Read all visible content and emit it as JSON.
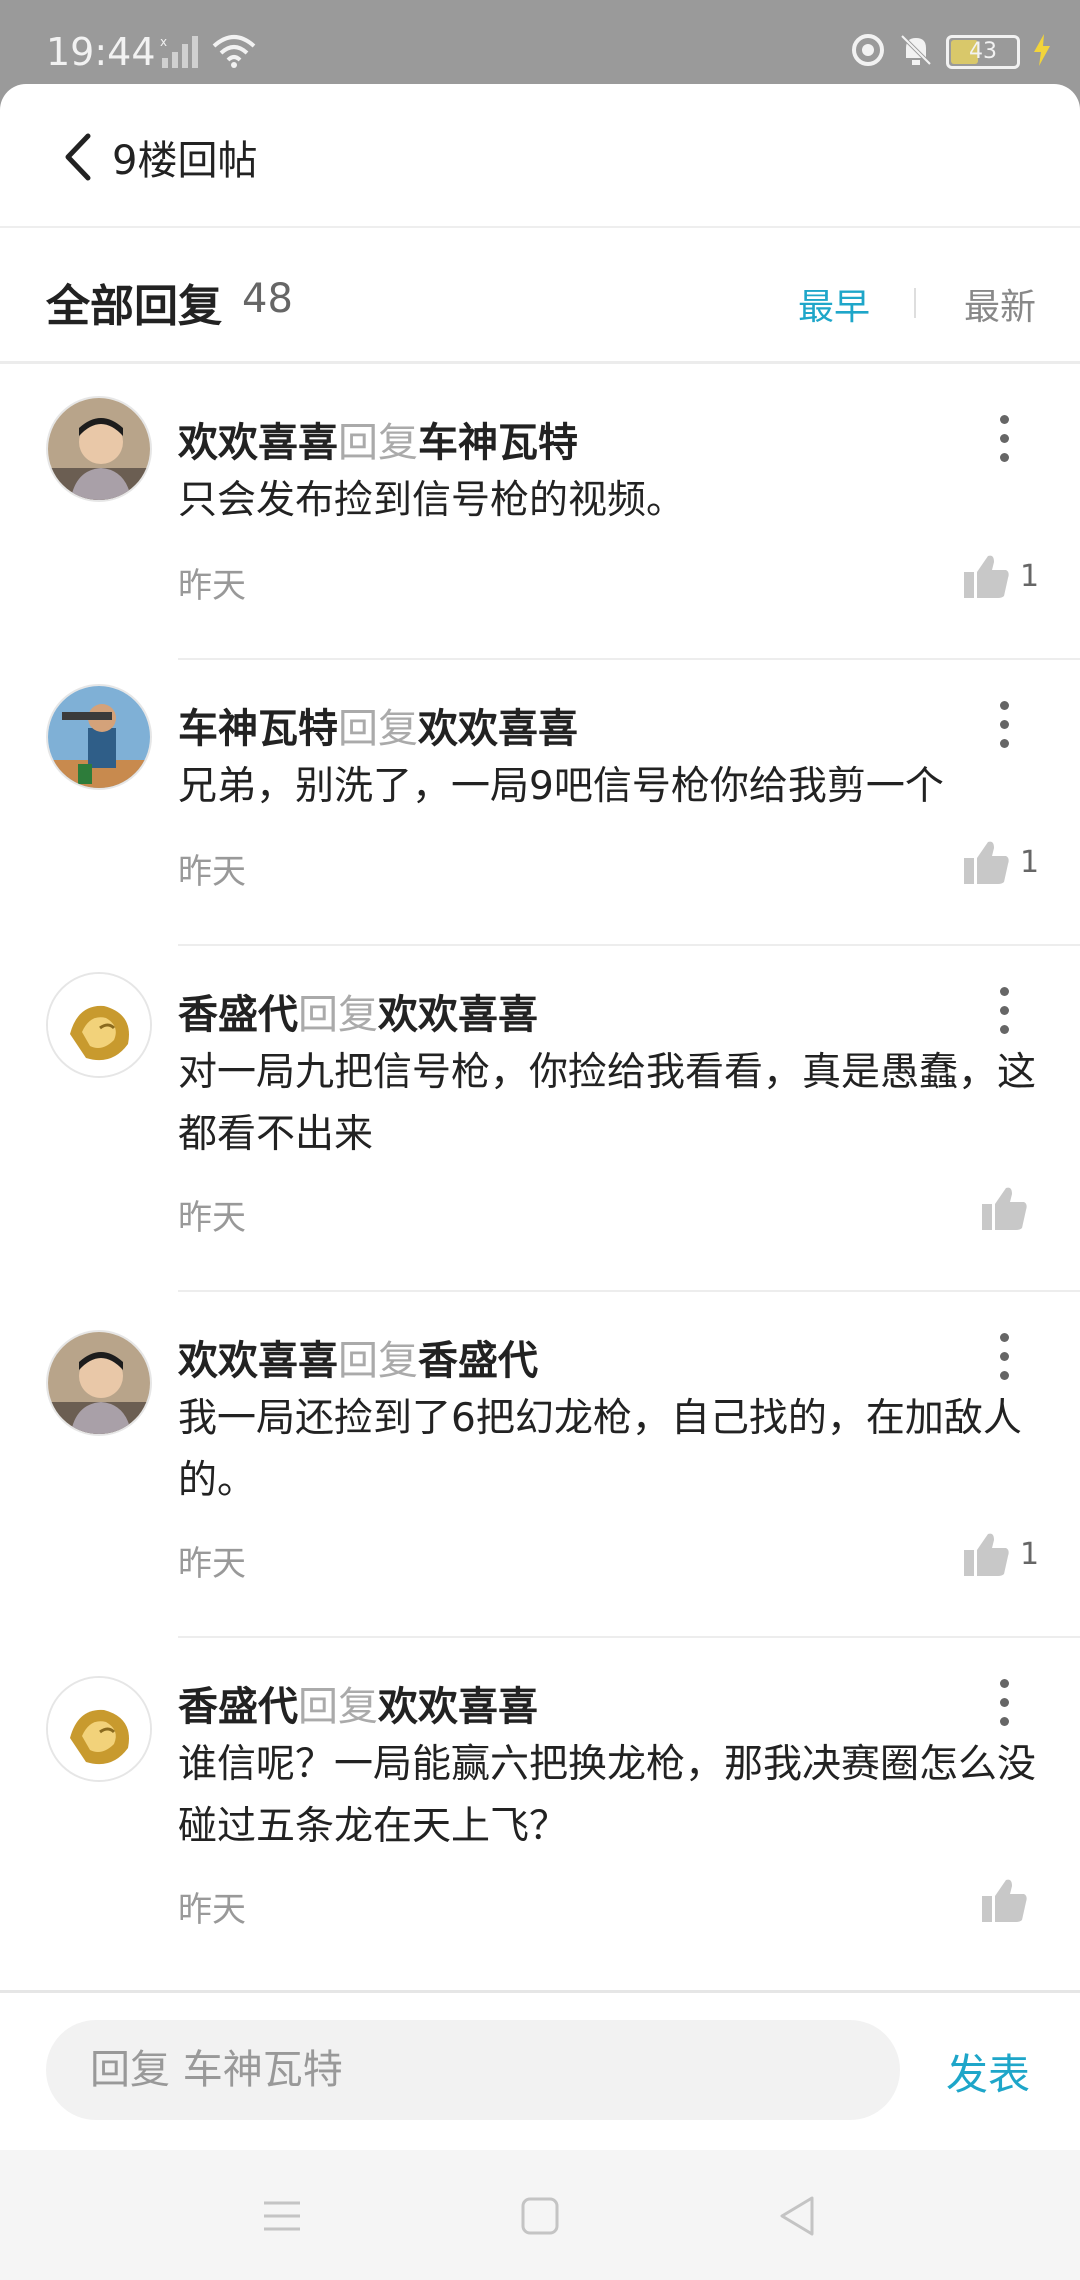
{
  "status_bar": {
    "time": "19:44",
    "battery": "43",
    "icons": [
      "signal-icon",
      "wifi-icon",
      "alarm-icon",
      "mute-icon",
      "battery-icon",
      "charging-icon"
    ]
  },
  "header": {
    "title": "9楼回帖"
  },
  "section": {
    "title": "全部回复",
    "count": "48",
    "sort_earliest": "最早",
    "sort_newest": "最新",
    "accent_color": "#1ea6c9"
  },
  "replies": [
    {
      "author": "欢欢喜喜",
      "verb": "回复",
      "target": "车神瓦特",
      "text": "只会发布捡到信号枪的视频。",
      "time": "昨天",
      "likes": "1",
      "avatar": "boy-avatar"
    },
    {
      "author": "车神瓦特",
      "verb": "回复",
      "target": "欢欢喜喜",
      "text": "兄弟，别洗了，一局9吧信号枪你给我剪一个",
      "time": "昨天",
      "likes": "1",
      "avatar": "game-character-avatar"
    },
    {
      "author": "香盛代",
      "verb": "回复",
      "target": "欢欢喜喜",
      "text": "对一局九把信号枪，你捡给我看看，真是愚蠢，这都看不出来",
      "time": "昨天",
      "likes": "",
      "avatar": "durian-avatar"
    },
    {
      "author": "欢欢喜喜",
      "verb": "回复",
      "target": "香盛代",
      "text": "我一局还捡到了6把幻龙枪，自己找的，在加敌人的。",
      "time": "昨天",
      "likes": "1",
      "avatar": "boy-avatar"
    },
    {
      "author": "香盛代",
      "verb": "回复",
      "target": "欢欢喜喜",
      "text": "谁信呢？一局能赢六把换龙枪，那我决赛圈怎么没碰过五条龙在天上飞？",
      "time": "昨天",
      "likes": "",
      "avatar": "durian-avatar"
    }
  ],
  "composer": {
    "placeholder": "回复 车神瓦特",
    "submit_label": "发表"
  },
  "nav": {
    "icons": [
      "menu-icon",
      "home-icon",
      "back-triangle-icon"
    ]
  }
}
